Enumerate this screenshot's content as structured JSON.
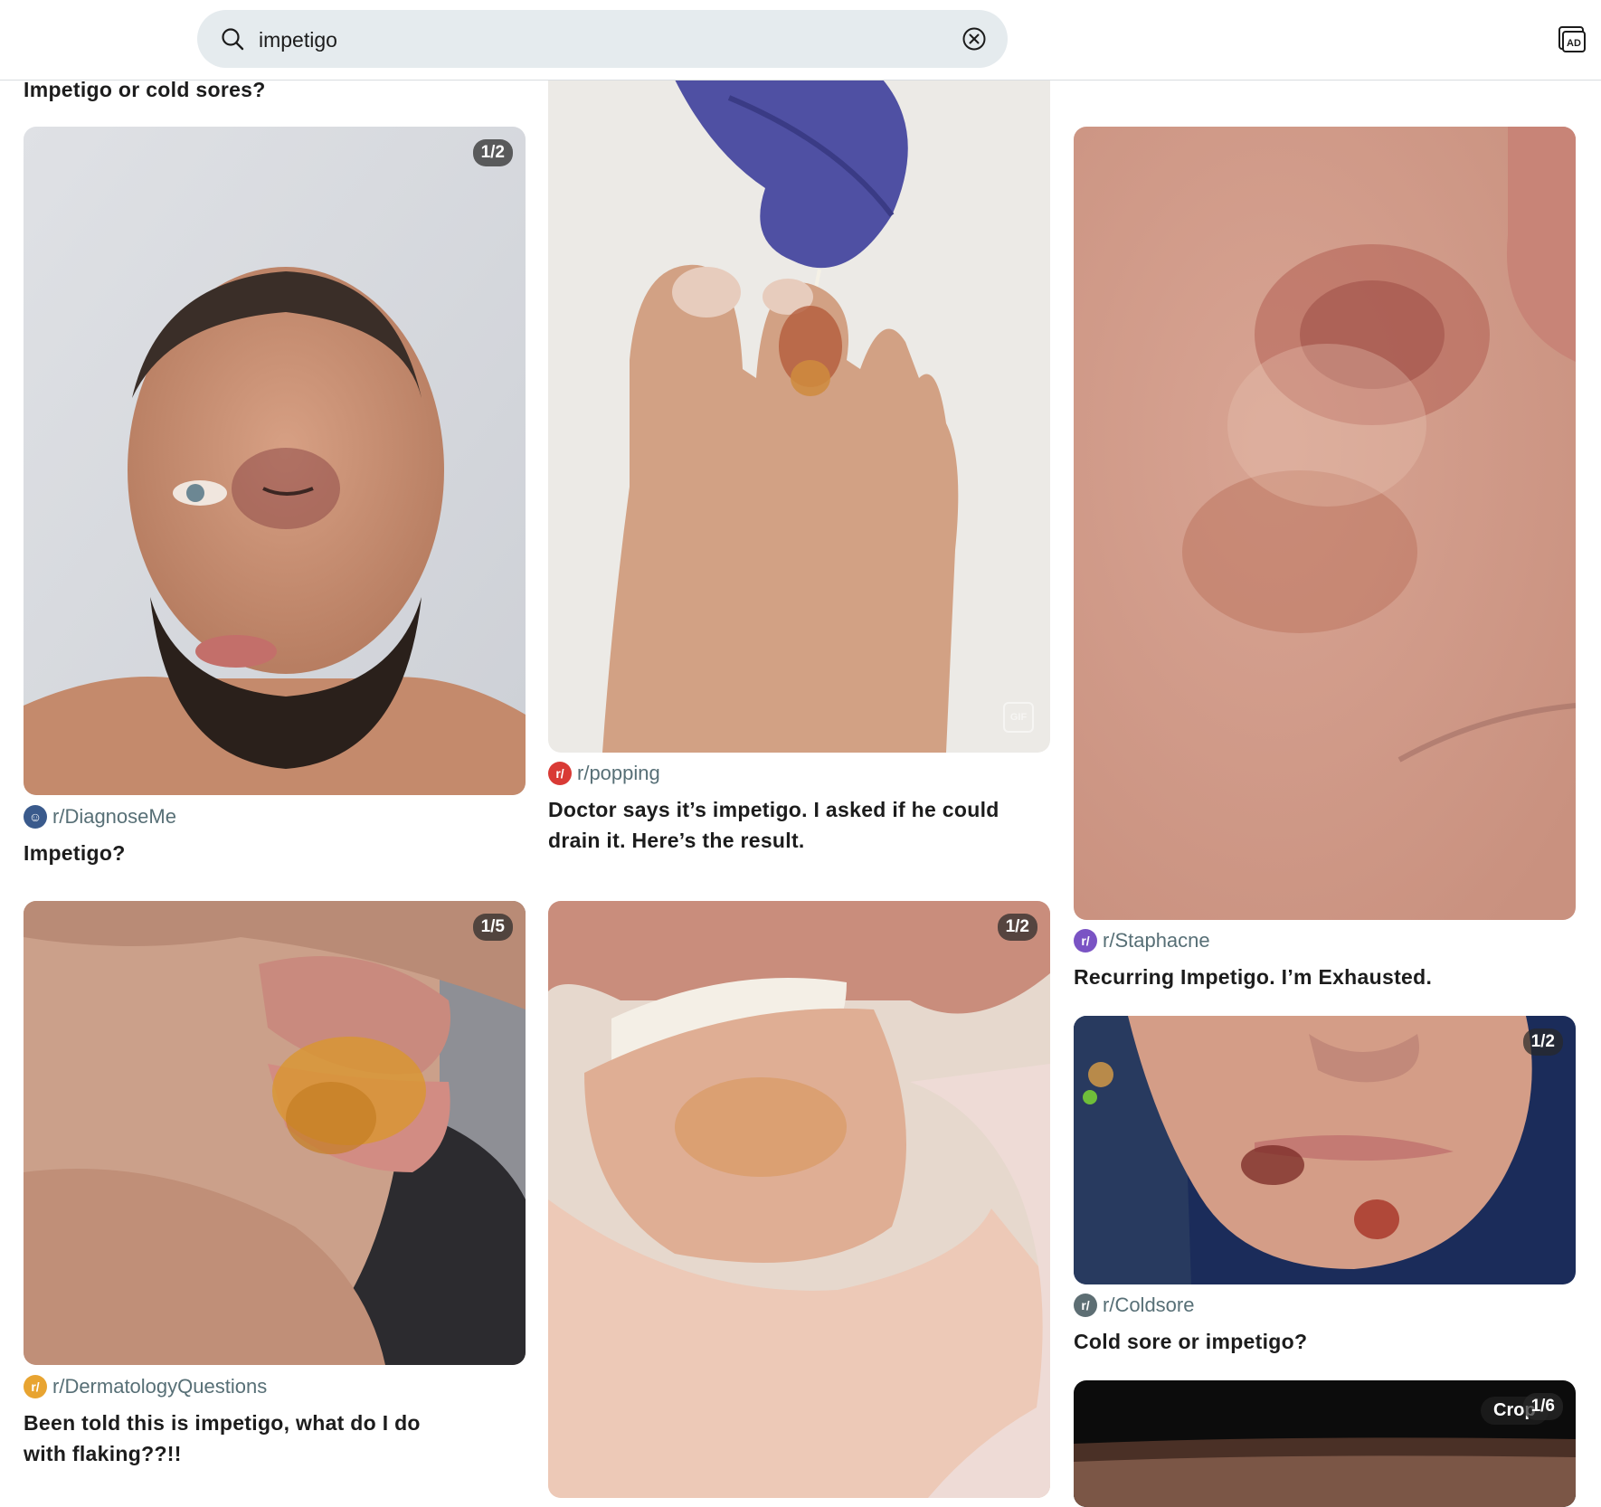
{
  "search": {
    "query": "impetigo"
  },
  "header": {
    "ad_label": "AD"
  },
  "posts": {
    "p0": {
      "title": "Impetigo or cold sores?"
    },
    "p1": {
      "badge": "1/2",
      "subreddit": "r/DiagnoseMe",
      "title": "Impetigo?"
    },
    "p2": {
      "badge": "GIF",
      "subreddit": "r/popping",
      "title": "Doctor says it’s impetigo. I asked if he could drain it. Here’s the result."
    },
    "p3": {
      "subreddit": "r/Staphacne",
      "title": "Recurring Impetigo. I’m Exhausted."
    },
    "p4": {
      "badge": "1/5",
      "subreddit": "r/DermatologyQuestions",
      "title": "Been told this is impetigo, what do I do with flaking??!!"
    },
    "p5": {
      "badge": "1/2"
    },
    "p6": {
      "badge": "1/2",
      "subreddit": "r/Coldsore",
      "title": "Cold sore or impetigo?"
    },
    "p7": {
      "badge": "1/6",
      "crop_label": "Crop"
    }
  },
  "colors": {
    "accent_text": "#576f76",
    "search_bg": "#e5ebee",
    "diagnoseme_icon": "#3a5a8c",
    "popping_icon": "#d93a35",
    "staphacne_icon": "#7a53c4",
    "dermatology_icon": "#e8a431",
    "coldsore_icon": "#5d6e73"
  },
  "icons": {
    "search": "search-icon",
    "clear": "clear-circle-icon",
    "ad": "ad-icon"
  }
}
